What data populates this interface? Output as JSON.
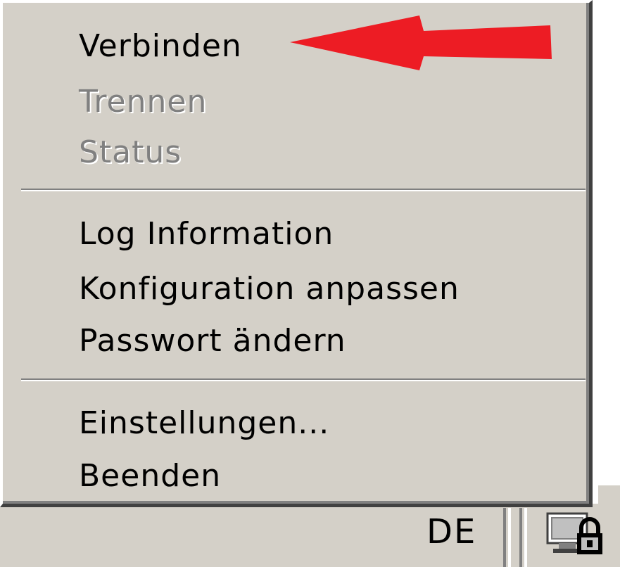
{
  "menu": {
    "items": [
      {
        "label": "Verbinden",
        "enabled": true
      },
      {
        "label": "Trennen",
        "enabled": false
      },
      {
        "label": "Status",
        "enabled": false
      },
      {
        "label": "Log Information",
        "enabled": true
      },
      {
        "label": "Konfiguration anpassen",
        "enabled": true
      },
      {
        "label": "Passwort ändern",
        "enabled": true
      },
      {
        "label": "Einstellungen...",
        "enabled": true
      },
      {
        "label": "Beenden",
        "enabled": true
      }
    ]
  },
  "annotation": {
    "arrow_color": "#ed1c24",
    "points_to": "Verbinden"
  },
  "taskbar": {
    "language": "DE",
    "tray_icon": "vpn-lock-icon"
  },
  "colors": {
    "menu_bg": "#d4d0c8",
    "disabled_text": "#808080",
    "text": "#000000"
  }
}
